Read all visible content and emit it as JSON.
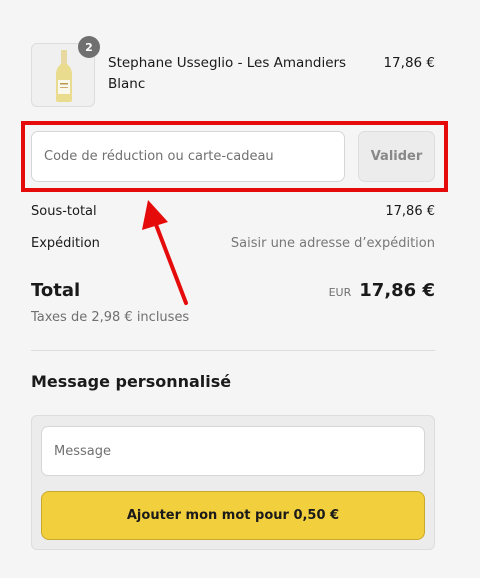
{
  "cart": {
    "item": {
      "quantity": "2",
      "name": "Stephane Usseglio - Les Amandiers Blanc",
      "price": "17,86 €"
    }
  },
  "discount": {
    "placeholder": "Code de réduction ou carte-cadeau",
    "button_label": "Valider"
  },
  "summary": {
    "subtotal_label": "Sous-total",
    "subtotal_value": "17,86 €",
    "shipping_label": "Expédition",
    "shipping_value": "Saisir une adresse d’expédition",
    "total_label": "Total",
    "currency": "EUR",
    "total_value": "17,86 €",
    "tax_note": "Taxes de 2,98 € incluses"
  },
  "message": {
    "title": "Message personnalisé",
    "placeholder": "Message",
    "button_label": "Ajouter mon mot pour 0,50 €"
  },
  "colors": {
    "highlight": "#e60b0b",
    "accent_button": "#f2cf3c"
  }
}
